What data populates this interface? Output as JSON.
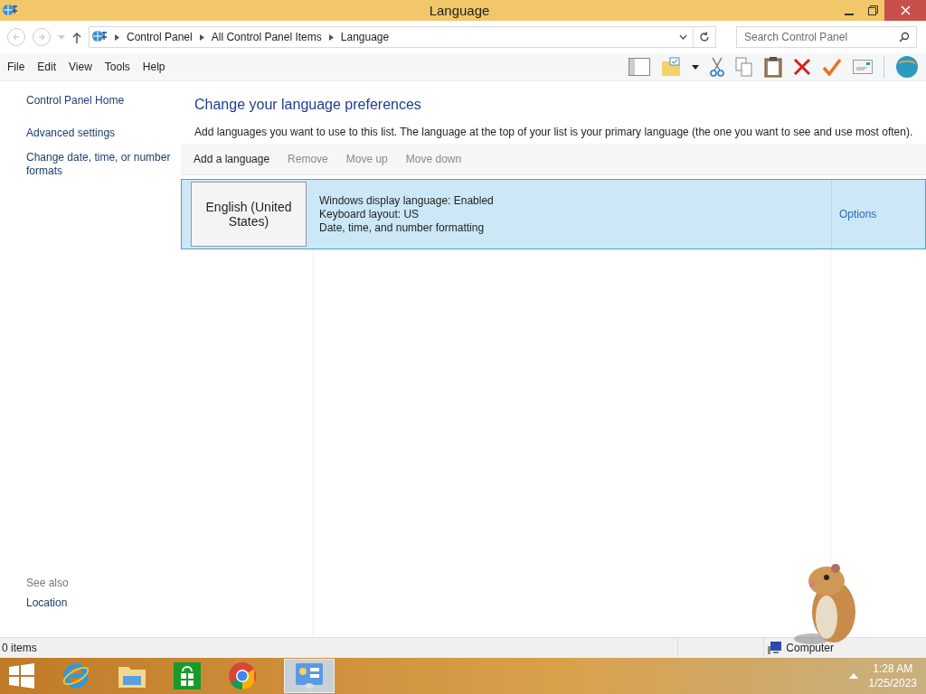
{
  "window": {
    "title": "Language"
  },
  "address_bar": {
    "breadcrumbs": [
      "Control Panel",
      "All Control Panel Items",
      "Language"
    ],
    "search_placeholder": "Search Control Panel"
  },
  "menu_bar": [
    "File",
    "Edit",
    "View",
    "Tools",
    "Help"
  ],
  "sidebar": {
    "items": [
      "Control Panel Home",
      "Advanced settings",
      "Change date, time, or number formats"
    ],
    "see_also_heading": "See also",
    "see_also_items": [
      "Location"
    ]
  },
  "main": {
    "heading": "Change your language preferences",
    "description": "Add languages you want to use to this list. The language at the top of your list is your primary language (the one you want to see and use most often).",
    "actions": [
      {
        "label": "Add a language",
        "disabled": false
      },
      {
        "label": "Remove",
        "disabled": true
      },
      {
        "label": "Move up",
        "disabled": true
      },
      {
        "label": "Move down",
        "disabled": true
      }
    ],
    "languages": [
      {
        "name": "English (United States)",
        "details": [
          "Windows display language: Enabled",
          "Keyboard layout: US",
          "Date, time, and number formatting"
        ],
        "options_link": "Options",
        "selected": true
      }
    ]
  },
  "status_bar": {
    "items_count": "0 items",
    "location": "Computer"
  },
  "taskbar": {
    "time": "1:28 AM",
    "date": "1/25/2023"
  }
}
